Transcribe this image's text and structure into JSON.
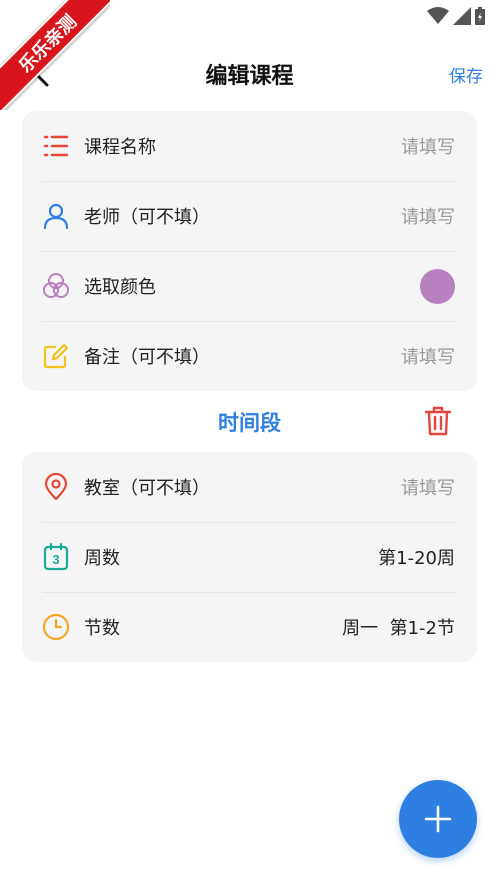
{
  "watermark": {
    "text": "乐乐亲测",
    "color": "#d8141c"
  },
  "header": {
    "title": "编辑课程",
    "save_label": "保存",
    "accent": "#2f7fe2"
  },
  "course_card": {
    "rows": [
      {
        "icon": "list-icon",
        "label": "课程名称",
        "value": "请填写"
      },
      {
        "icon": "person-icon",
        "label": "老师（可不填）",
        "value": "请填写"
      },
      {
        "icon": "color-palette-icon",
        "label": "选取颜色",
        "color": "#b980c0"
      },
      {
        "icon": "edit-icon",
        "label": "备注（可不填）",
        "value": "请填写"
      }
    ]
  },
  "time_section": {
    "title": "时间段"
  },
  "time_card": {
    "rows": [
      {
        "icon": "location-icon",
        "label": "教室（可不填）",
        "value": "请填写"
      },
      {
        "icon": "calendar-icon",
        "label": "周数",
        "value": "第1-20周",
        "calendar_day": "3"
      },
      {
        "icon": "clock-icon",
        "label": "节数",
        "value": "周一  第1-2节"
      }
    ]
  }
}
